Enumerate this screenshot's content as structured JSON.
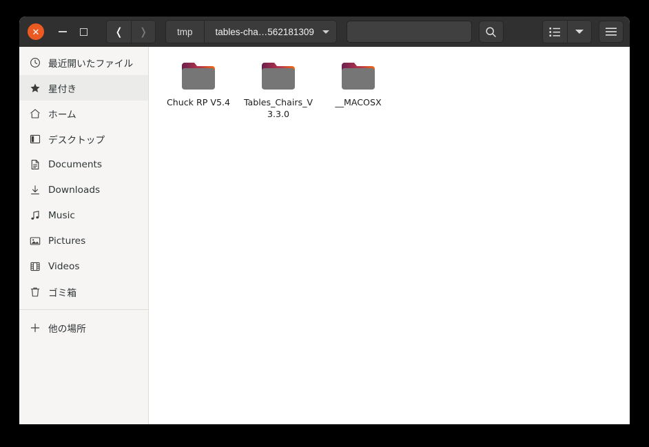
{
  "window": {
    "titlebar": {
      "close_label": "✕",
      "close_icon": "close-icon",
      "minimize_icon": "minimize-icon",
      "maximize_icon": "maximize-icon",
      "close_color": "#ec5a23",
      "background": "#303030"
    },
    "navigation": {
      "back_label": "❬",
      "forward_label": "❭",
      "back_enabled": true,
      "forward_enabled": false
    },
    "pathbar": {
      "crumbs": [
        {
          "label": "tmp",
          "current": false
        },
        {
          "label": "tables-cha…562181309",
          "current": true
        }
      ]
    },
    "search": {
      "value": "",
      "placeholder": "",
      "button_icon": "search-icon"
    },
    "view_controls": {
      "list_view_icon": "list-view-icon",
      "view_dropdown_icon": "chevron-down-icon",
      "menu_icon": "hamburger-menu-icon"
    }
  },
  "sidebar": {
    "items": [
      {
        "label": "最近開いたファイル",
        "icon": "clock-icon",
        "selected": false
      },
      {
        "label": "星付き",
        "icon": "star-icon",
        "selected": true
      },
      {
        "label": "ホーム",
        "icon": "home-icon",
        "selected": false
      },
      {
        "label": "デスクトップ",
        "icon": "desktop-icon",
        "selected": false
      },
      {
        "label": "Documents",
        "icon": "document-icon",
        "selected": false
      },
      {
        "label": "Downloads",
        "icon": "download-icon",
        "selected": false
      },
      {
        "label": "Music",
        "icon": "music-note-icon",
        "selected": false
      },
      {
        "label": "Pictures",
        "icon": "picture-icon",
        "selected": false
      },
      {
        "label": "Videos",
        "icon": "film-icon",
        "selected": false
      },
      {
        "label": "ゴミ箱",
        "icon": "trash-icon",
        "selected": false
      }
    ],
    "other_locations": {
      "label": "他の場所",
      "icon": "plus-icon"
    }
  },
  "content": {
    "files": [
      {
        "name": "Chuck RP V5.4",
        "type": "folder",
        "icon": "folder-icon"
      },
      {
        "name": "Tables_Chairs_V3.3.0",
        "type": "folder",
        "icon": "folder-icon"
      },
      {
        "name": "__MACOSX",
        "type": "folder",
        "icon": "folder-icon"
      }
    ],
    "folder_tab_color_start": "#7b2150",
    "folder_tab_color_end": "#f06010",
    "folder_body_color": "#767676"
  }
}
